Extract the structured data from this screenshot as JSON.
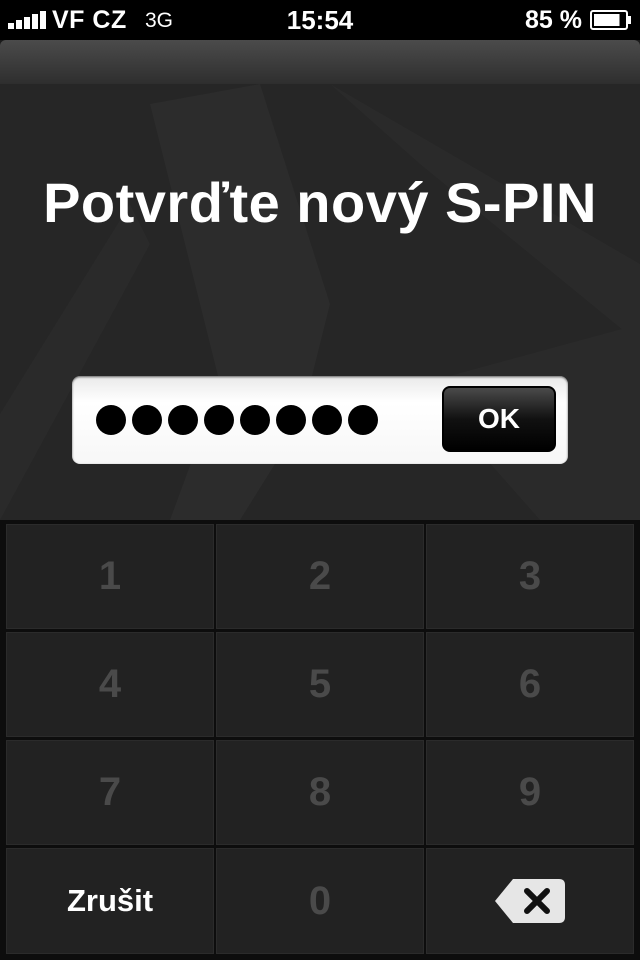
{
  "status_bar": {
    "carrier": "VF CZ",
    "network": "3G",
    "time": "15:54",
    "battery": "85 %",
    "battery_level": 0.85
  },
  "dialog": {
    "title": "Potvrďte nový S-PIN",
    "pin_length": 8,
    "ok_label": "OK"
  },
  "keypad": {
    "keys": [
      "1",
      "2",
      "3",
      "4",
      "5",
      "6",
      "7",
      "8",
      "9"
    ],
    "cancel_label": "Zrušit",
    "zero": "0",
    "backspace_icon": "backspace-icon"
  },
  "colors": {
    "background": "#262626",
    "keypad_key": "#222222",
    "key_text_disabled": "#4a4a4a",
    "text": "#ffffff"
  }
}
